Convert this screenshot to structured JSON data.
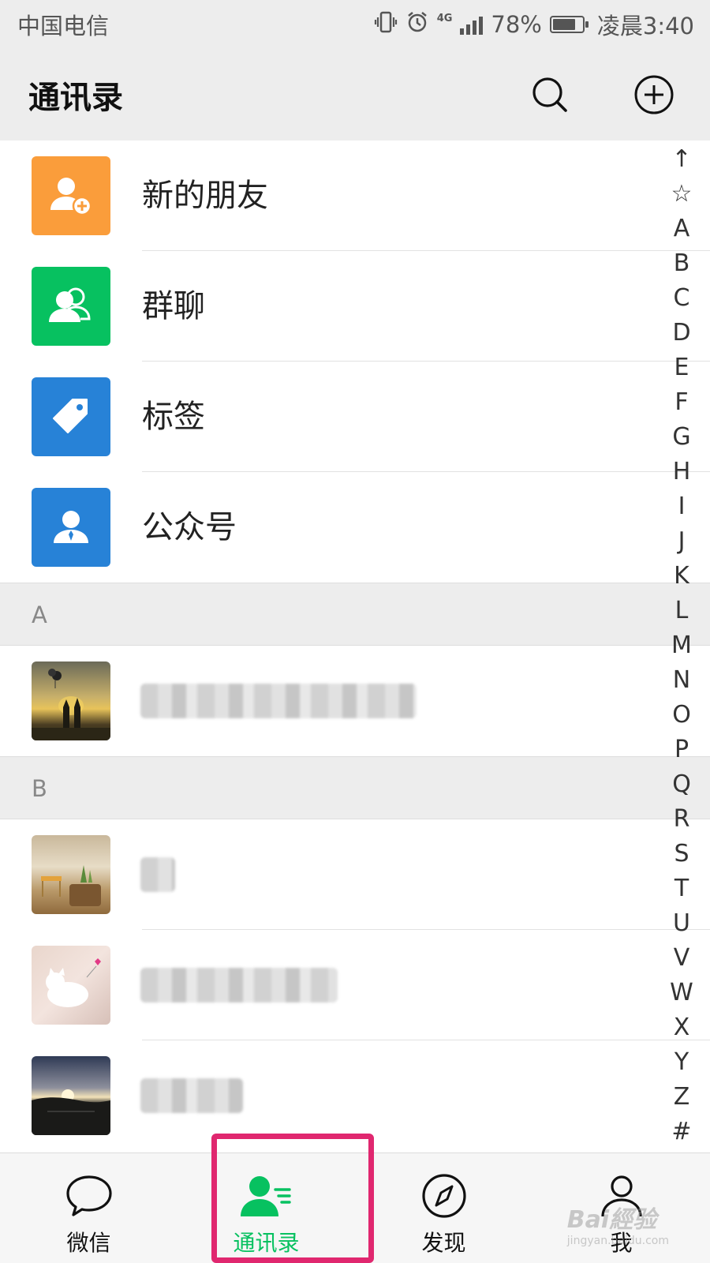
{
  "status_bar": {
    "carrier": "中国电信",
    "network": "4G",
    "battery": "78%",
    "battery_level": 0.78,
    "time": "凌晨3:40",
    "icons": [
      "vibrate-icon",
      "alarm-icon",
      "signal-icon",
      "battery-icon"
    ]
  },
  "header": {
    "title": "通讯录",
    "icons": [
      "search-icon",
      "add-circle-icon"
    ]
  },
  "shortcuts": [
    {
      "label": "新的朋友",
      "icon": "add-friend-icon",
      "color": "#fa9d3b"
    },
    {
      "label": "群聊",
      "icon": "group-icon",
      "color": "#07c160"
    },
    {
      "label": "标签",
      "icon": "tag-icon",
      "color": "#2782d7"
    },
    {
      "label": "公众号",
      "icon": "official-account-icon",
      "color": "#2782d7"
    }
  ],
  "sections": [
    {
      "letter": "A",
      "contacts": [
        {
          "name": "",
          "avatar": "couple-sunset-photo"
        }
      ]
    },
    {
      "letter": "B",
      "contacts": [
        {
          "name": "",
          "avatar": "room-photo"
        },
        {
          "name": "",
          "avatar": "cat-photo"
        },
        {
          "name": "",
          "avatar": "sunset-lake-photo"
        }
      ]
    }
  ],
  "index_letters": [
    "↑",
    "☆",
    "A",
    "B",
    "C",
    "D",
    "E",
    "F",
    "G",
    "H",
    "I",
    "J",
    "K",
    "L",
    "M",
    "N",
    "O",
    "P",
    "Q",
    "R",
    "S",
    "T",
    "U",
    "V",
    "W",
    "X",
    "Y",
    "Z",
    "#"
  ],
  "tabs": [
    {
      "label": "微信",
      "icon": "chat-bubble-icon",
      "active": false
    },
    {
      "label": "通讯录",
      "icon": "contacts-icon",
      "active": true
    },
    {
      "label": "发现",
      "icon": "compass-icon",
      "active": false
    },
    {
      "label": "我",
      "icon": "person-icon",
      "active": false
    }
  ],
  "colors": {
    "accent": "#07c160",
    "highlight": "#e0276f"
  },
  "watermark": {
    "brand": "Bai經验",
    "url": "jingyan.baidu.com"
  }
}
